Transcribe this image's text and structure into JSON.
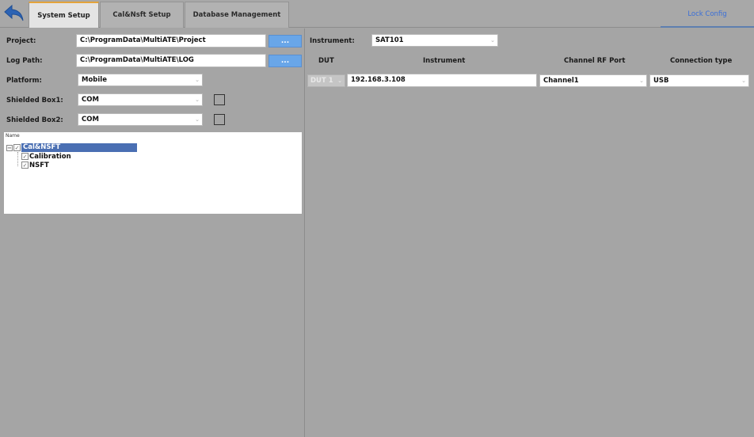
{
  "tabs": [
    {
      "label": "System Setup",
      "active": true
    },
    {
      "label": "Cal&Nsft Setup",
      "active": false
    },
    {
      "label": "Database Management",
      "active": false
    }
  ],
  "lock_config": "Lock Config",
  "icons": {
    "back": "back-arrow-icon"
  },
  "colors": {
    "accent_blue": "#3a6fd8",
    "browse_blue": "#69a6e8",
    "tab_active_top": "#e4a33b",
    "tree_selected": "#4a6fb3"
  },
  "left": {
    "project": {
      "label": "Project:",
      "value": "C:\\ProgramData\\MultiATE\\Project",
      "browse": "..."
    },
    "log_path": {
      "label": "Log Path:",
      "value": "C:\\ProgramData\\MultiATE\\LOG",
      "browse": "..."
    },
    "platform": {
      "label": "Platform:",
      "value": "Mobile"
    },
    "shielded_box1": {
      "label": "Shielded Box1:",
      "value": "COM"
    },
    "shielded_box2": {
      "label": "Shielded Box2:",
      "value": "COM"
    },
    "tree": {
      "header": "Name",
      "root": {
        "label": "Cal&NSFT",
        "children": [
          {
            "label": "Calibration"
          },
          {
            "label": "NSFT"
          }
        ]
      }
    }
  },
  "right": {
    "instrument_label": "Instrument:",
    "instrument_value": "SAT101",
    "columns": [
      "DUT",
      "Instrument",
      "Channel RF Port",
      "Connection type"
    ],
    "row": {
      "dut": "DUT 1",
      "instrument": "192.168.3.108",
      "channel": "Channel1",
      "connection": "USB"
    }
  }
}
